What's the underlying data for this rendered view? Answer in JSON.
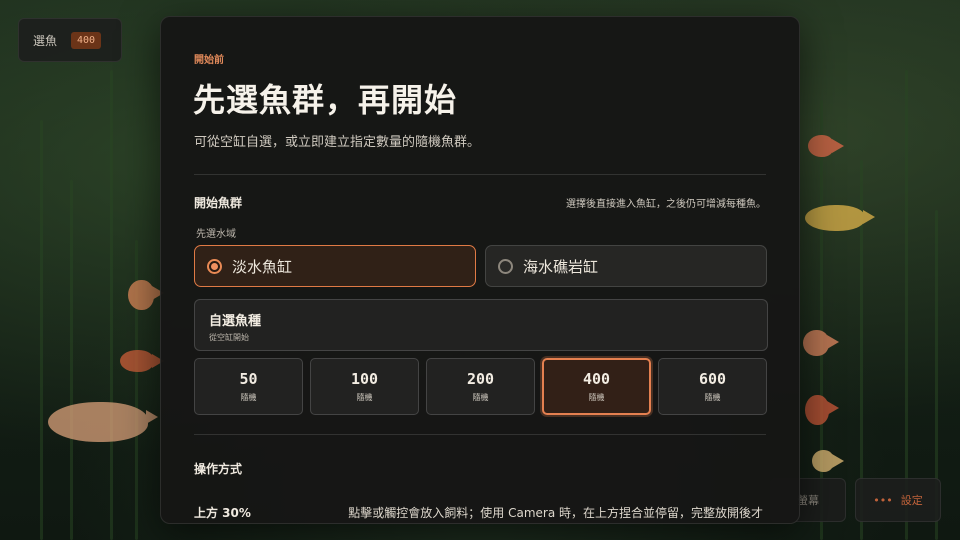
{
  "hud": {
    "fish_label": "選魚",
    "fish_count": "400",
    "right_button_label": "螢幕",
    "settings_icon_text": "•••",
    "settings_label": "設定"
  },
  "modal": {
    "eyebrow": "開始前",
    "title": "先選魚群，再開始",
    "subtitle": "可從空缸自選，或立即建立指定數量的隨機魚群。",
    "start_section": {
      "title": "開始魚群",
      "hint": "選擇後直接進入魚缸，之後仍可增減每種魚。",
      "water_label": "先選水域",
      "water_options": [
        {
          "label": "淡水魚缸",
          "selected": true
        },
        {
          "label": "海水礁岩缸",
          "selected": false
        }
      ],
      "custom": {
        "title": "自選魚種",
        "sub": "從空缸開始"
      },
      "presets": [
        {
          "count": "50",
          "sub": "隨機",
          "selected": false
        },
        {
          "count": "100",
          "sub": "隨機",
          "selected": false
        },
        {
          "count": "200",
          "sub": "隨機",
          "selected": false
        },
        {
          "count": "400",
          "sub": "隨機",
          "selected": true
        },
        {
          "count": "600",
          "sub": "隨機",
          "selected": false
        }
      ]
    },
    "ops_section": {
      "title": "操作方式",
      "row_label": "上方 30%",
      "row_text": "點擊或觸控會放入飼料；使用 Camera 時，在上方捏合並停留，完整放開後才"
    }
  }
}
